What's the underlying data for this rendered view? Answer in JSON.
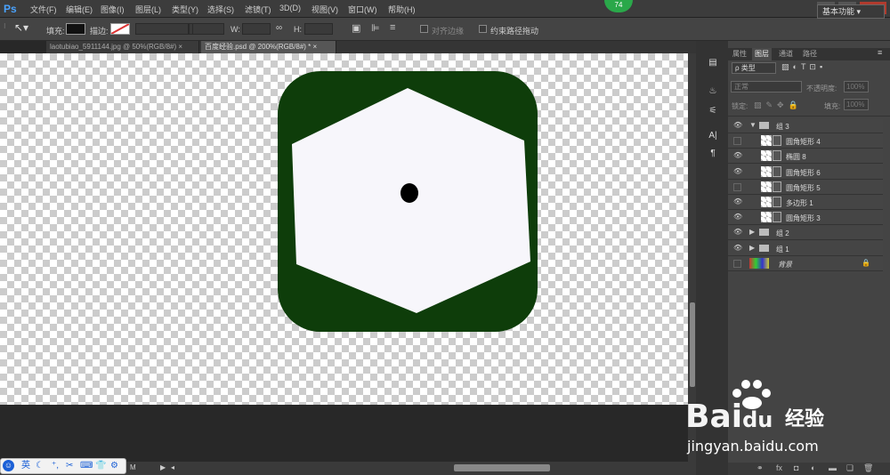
{
  "app": {
    "logo": "Ps"
  },
  "menu": [
    "文件(F)",
    "编辑(E)",
    "图像(I)",
    "图层(L)",
    "类型(Y)",
    "选择(S)",
    "滤镜(T)",
    "3D(D)",
    "视图(V)",
    "窗口(W)",
    "帮助(H)"
  ],
  "badge": "74",
  "window_buttons": [
    "-",
    "❐",
    "✕"
  ],
  "options": {
    "fill_label": "填充:",
    "stroke_label": "描边:",
    "w_label": "W:",
    "h_label": "H:",
    "align_edges": "对齐边缘",
    "constrain_path": "约束路径拖动",
    "workspace": "基本功能",
    "fill_color": "#111111",
    "stroke_color": "#ffffff"
  },
  "tabs": [
    {
      "label": "laotubiao_5911144.jpg @ 50%(RGB/8#)",
      "close": "×",
      "active": false
    },
    {
      "label": "百度经验.psd @ 200%(RGB/8#) *",
      "close": "×",
      "active": true
    }
  ],
  "colors": {
    "foreground": "#111111",
    "background": "#4a5a6a",
    "canvas_shape": "#0e3d0a",
    "hexagon": "#f7f6fb",
    "dot": "#000000"
  },
  "panel": {
    "tabs": [
      "属性",
      "图层",
      "通道",
      "路径"
    ],
    "active_tab": "图层",
    "filter_kind": "ρ 类型",
    "blend_mode": "正常",
    "opacity_label": "不透明度:",
    "opacity_value": "100%",
    "lock_label": "锁定:",
    "fill_label": "填充:",
    "fill_value": "100%"
  },
  "layers": [
    {
      "name": "组 3",
      "visible": true,
      "type": "group-open"
    },
    {
      "name": "圆角矩形 4",
      "visible": false,
      "type": "shape"
    },
    {
      "name": "椭圆 8",
      "visible": true,
      "type": "shape"
    },
    {
      "name": "圆角矩形 6",
      "visible": true,
      "type": "shape"
    },
    {
      "name": "圆角矩形 5",
      "visible": false,
      "type": "shape"
    },
    {
      "name": "多边形 1",
      "visible": true,
      "type": "shape"
    },
    {
      "name": "圆角矩形 3",
      "visible": true,
      "type": "shape"
    },
    {
      "name": "组 2",
      "visible": true,
      "type": "group"
    },
    {
      "name": "组 1",
      "visible": true,
      "type": "group"
    },
    {
      "name": "背景",
      "visible": false,
      "type": "background"
    }
  ],
  "ime": [
    "英",
    "☾",
    "⁺,",
    "✂",
    "⌨",
    "👕",
    "⚙"
  ],
  "status": "M",
  "watermark": {
    "bai": "Bai",
    "du": "du",
    "text": "经验",
    "url": "jingyan.baidu.com"
  }
}
